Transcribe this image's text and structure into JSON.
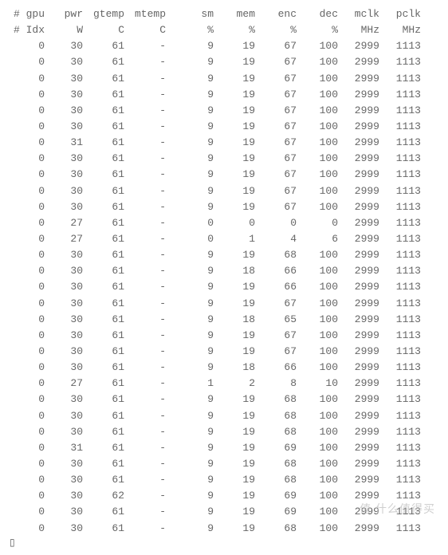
{
  "headers1": [
    "# gpu",
    "pwr",
    "gtemp",
    "mtemp",
    "sm",
    "mem",
    "enc",
    "dec",
    "mclk",
    "pclk"
  ],
  "headers2": [
    "# Idx",
    "W",
    "C",
    "C",
    "%",
    "%",
    "%",
    "%",
    "MHz",
    "MHz"
  ],
  "rows": [
    [
      "0",
      "30",
      "61",
      "-",
      "9",
      "19",
      "67",
      "100",
      "2999",
      "1113"
    ],
    [
      "0",
      "30",
      "61",
      "-",
      "9",
      "19",
      "67",
      "100",
      "2999",
      "1113"
    ],
    [
      "0",
      "30",
      "61",
      "-",
      "9",
      "19",
      "67",
      "100",
      "2999",
      "1113"
    ],
    [
      "0",
      "30",
      "61",
      "-",
      "9",
      "19",
      "67",
      "100",
      "2999",
      "1113"
    ],
    [
      "0",
      "30",
      "61",
      "-",
      "9",
      "19",
      "67",
      "100",
      "2999",
      "1113"
    ],
    [
      "0",
      "30",
      "61",
      "-",
      "9",
      "19",
      "67",
      "100",
      "2999",
      "1113"
    ],
    [
      "0",
      "31",
      "61",
      "-",
      "9",
      "19",
      "67",
      "100",
      "2999",
      "1113"
    ],
    [
      "0",
      "30",
      "61",
      "-",
      "9",
      "19",
      "67",
      "100",
      "2999",
      "1113"
    ],
    [
      "0",
      "30",
      "61",
      "-",
      "9",
      "19",
      "67",
      "100",
      "2999",
      "1113"
    ],
    [
      "0",
      "30",
      "61",
      "-",
      "9",
      "19",
      "67",
      "100",
      "2999",
      "1113"
    ],
    [
      "0",
      "30",
      "61",
      "-",
      "9",
      "19",
      "67",
      "100",
      "2999",
      "1113"
    ],
    [
      "0",
      "27",
      "61",
      "-",
      "0",
      "0",
      "0",
      "0",
      "2999",
      "1113"
    ],
    [
      "0",
      "27",
      "61",
      "-",
      "0",
      "1",
      "4",
      "6",
      "2999",
      "1113"
    ],
    [
      "0",
      "30",
      "61",
      "-",
      "9",
      "19",
      "68",
      "100",
      "2999",
      "1113"
    ],
    [
      "0",
      "30",
      "61",
      "-",
      "9",
      "18",
      "66",
      "100",
      "2999",
      "1113"
    ],
    [
      "0",
      "30",
      "61",
      "-",
      "9",
      "19",
      "66",
      "100",
      "2999",
      "1113"
    ],
    [
      "0",
      "30",
      "61",
      "-",
      "9",
      "19",
      "67",
      "100",
      "2999",
      "1113"
    ],
    [
      "0",
      "30",
      "61",
      "-",
      "9",
      "18",
      "65",
      "100",
      "2999",
      "1113"
    ],
    [
      "0",
      "30",
      "61",
      "-",
      "9",
      "19",
      "67",
      "100",
      "2999",
      "1113"
    ],
    [
      "0",
      "30",
      "61",
      "-",
      "9",
      "19",
      "67",
      "100",
      "2999",
      "1113"
    ],
    [
      "0",
      "30",
      "61",
      "-",
      "9",
      "18",
      "66",
      "100",
      "2999",
      "1113"
    ],
    [
      "0",
      "27",
      "61",
      "-",
      "1",
      "2",
      "8",
      "10",
      "2999",
      "1113"
    ],
    [
      "0",
      "30",
      "61",
      "-",
      "9",
      "19",
      "68",
      "100",
      "2999",
      "1113"
    ],
    [
      "0",
      "30",
      "61",
      "-",
      "9",
      "19",
      "68",
      "100",
      "2999",
      "1113"
    ],
    [
      "0",
      "30",
      "61",
      "-",
      "9",
      "19",
      "68",
      "100",
      "2999",
      "1113"
    ],
    [
      "0",
      "31",
      "61",
      "-",
      "9",
      "19",
      "69",
      "100",
      "2999",
      "1113"
    ],
    [
      "0",
      "30",
      "61",
      "-",
      "9",
      "19",
      "68",
      "100",
      "2999",
      "1113"
    ],
    [
      "0",
      "30",
      "61",
      "-",
      "9",
      "19",
      "68",
      "100",
      "2999",
      "1113"
    ],
    [
      "0",
      "30",
      "62",
      "-",
      "9",
      "19",
      "69",
      "100",
      "2999",
      "1113"
    ],
    [
      "0",
      "30",
      "61",
      "-",
      "9",
      "19",
      "69",
      "100",
      "2999",
      "1113"
    ],
    [
      "0",
      "30",
      "61",
      "-",
      "9",
      "19",
      "68",
      "100",
      "2999",
      "1113"
    ]
  ],
  "watermark": "值 什么值得买",
  "cursor": "▯"
}
